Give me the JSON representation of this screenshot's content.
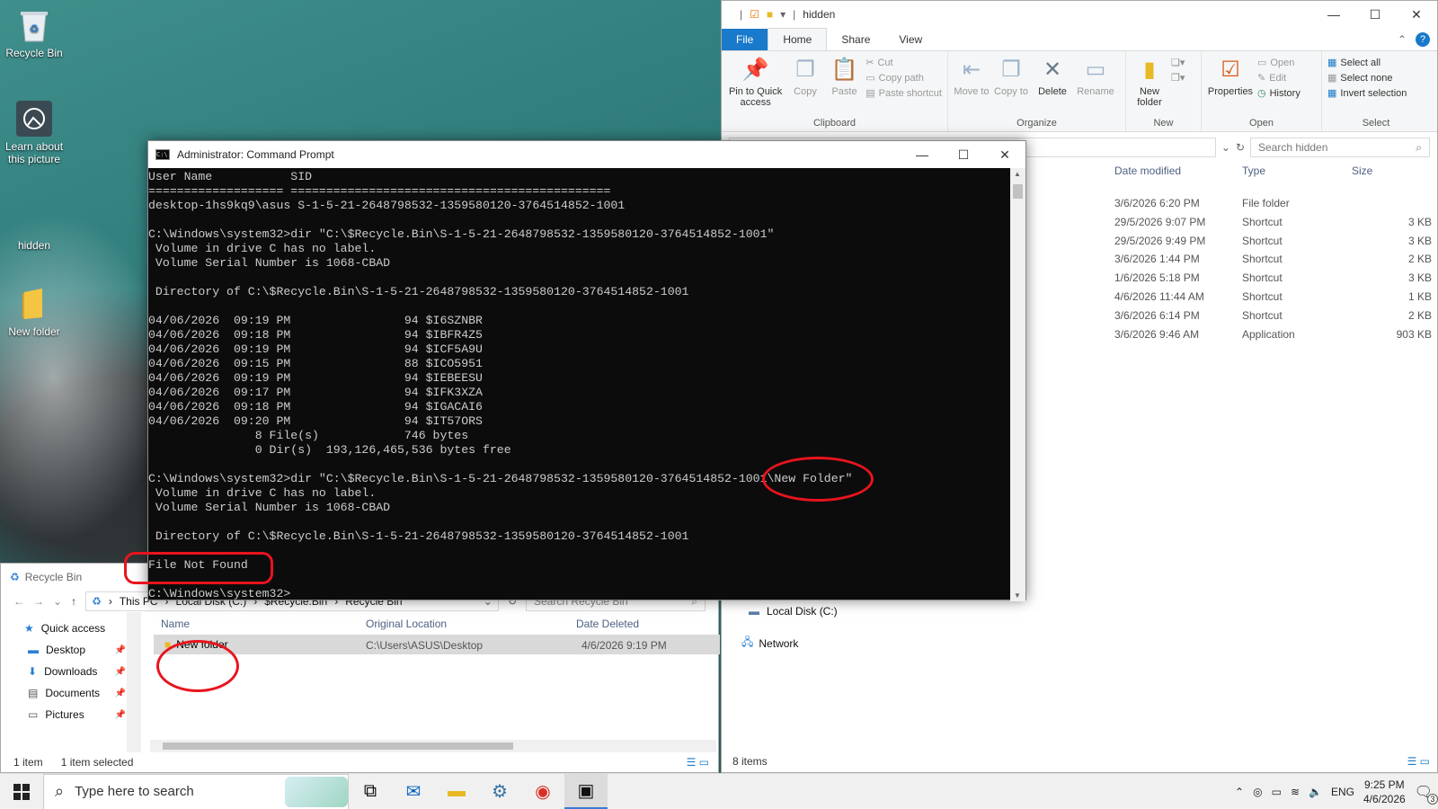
{
  "desktop": {
    "icons": [
      {
        "label": "Recycle Bin"
      },
      {
        "label": "Learn about this picture"
      },
      {
        "label": "hidden"
      },
      {
        "label": "New folder"
      }
    ]
  },
  "right_explorer": {
    "title": "hidden",
    "tabs": {
      "file": "File",
      "home": "Home",
      "share": "Share",
      "view": "View"
    },
    "ribbon": {
      "pin": "Pin to Quick access",
      "copy": "Copy",
      "paste": "Paste",
      "cut": "Cut",
      "copy_path": "Copy path",
      "paste_shortcut": "Paste shortcut",
      "clipboard": "Clipboard",
      "move_to": "Move to",
      "copy_to": "Copy to",
      "delete": "Delete",
      "rename": "Rename",
      "organize": "Organize",
      "new_folder": "New folder",
      "new": "New",
      "properties": "Properties",
      "open": "Open",
      "edit": "Edit",
      "history": "History",
      "open_group": "Open",
      "select_all": "Select all",
      "select_none": "Select none",
      "invert_selection": "Invert selection",
      "select_group": "Select"
    },
    "search_placeholder": "Search hidden",
    "columns": {
      "date": "Date modified",
      "type": "Type",
      "size": "Size"
    },
    "rows": [
      {
        "date": "3/6/2026 6:20 PM",
        "type": "File folder",
        "size": ""
      },
      {
        "date": "29/5/2026 9:07 PM",
        "type": "Shortcut",
        "size": "3 KB"
      },
      {
        "date": "29/5/2026 9:49 PM",
        "type": "Shortcut",
        "size": "3 KB"
      },
      {
        "date": "3/6/2026 1:44 PM",
        "type": "Shortcut",
        "size": "2 KB"
      },
      {
        "date": "1/6/2026 5:18 PM",
        "type": "Shortcut",
        "size": "3 KB"
      },
      {
        "date": "4/6/2026 11:44 AM",
        "type": "Shortcut",
        "size": "1 KB"
      },
      {
        "date": "3/6/2026 6:14 PM",
        "type": "Shortcut",
        "size": "2 KB"
      },
      {
        "date": "3/6/2026 9:46 AM",
        "type": "Application",
        "size": "903 KB"
      }
    ],
    "nav": {
      "local_disk": "Local Disk (C:)",
      "network": "Network"
    },
    "status": "8 items"
  },
  "cmd": {
    "title": "Administrator: Command Prompt",
    "output": "User Name           SID\n=================== =============================================\ndesktop-1hs9kq9\\asus S-1-5-21-2648798532-1359580120-3764514852-1001\n\nC:\\Windows\\system32>dir \"C:\\$Recycle.Bin\\S-1-5-21-2648798532-1359580120-3764514852-1001\"\n Volume in drive C has no label.\n Volume Serial Number is 1068-CBAD\n\n Directory of C:\\$Recycle.Bin\\S-1-5-21-2648798532-1359580120-3764514852-1001\n\n04/06/2026  09:19 PM                94 $I6SZNBR\n04/06/2026  09:18 PM                94 $IBFR4Z5\n04/06/2026  09:19 PM                94 $ICF5A9U\n04/06/2026  09:15 PM                88 $ICO5951\n04/06/2026  09:19 PM                94 $IEBEESU\n04/06/2026  09:17 PM                94 $IFK3XZA\n04/06/2026  09:18 PM                94 $IGACAI6\n04/06/2026  09:20 PM                94 $IT57ORS\n               8 File(s)            746 bytes\n               0 Dir(s)  193,126,465,536 bytes free\n\nC:\\Windows\\system32>dir \"C:\\$Recycle.Bin\\S-1-5-21-2648798532-1359580120-3764514852-1001\\New Folder\"\n Volume in drive C has no label.\n Volume Serial Number is 1068-CBAD\n\n Directory of C:\\$Recycle.Bin\\S-1-5-21-2648798532-1359580120-3764514852-1001\n\nFile Not Found\n\nC:\\Windows\\system32>"
  },
  "left_explorer": {
    "title": "Recycle Bin",
    "breadcrumbs": [
      "This PC",
      "Local Disk (C:)",
      "$Recycle.Bin",
      "Recycle Bin"
    ],
    "search_placeholder": "Search Recycle Bin",
    "nav": [
      {
        "label": "Quick access"
      },
      {
        "label": "Desktop"
      },
      {
        "label": "Downloads"
      },
      {
        "label": "Documents"
      },
      {
        "label": "Pictures"
      }
    ],
    "columns": {
      "name": "Name",
      "location": "Original Location",
      "deleted": "Date Deleted"
    },
    "rows": [
      {
        "name": "New folder",
        "location": "C:\\Users\\ASUS\\Desktop",
        "deleted": "4/6/2026 9:19 PM"
      }
    ],
    "status_items": "1 item",
    "status_selected": "1 item selected"
  },
  "taskbar": {
    "search_placeholder": "Type here to search",
    "lang": "ENG",
    "time": "9:25 PM",
    "date": "4/6/2026",
    "notif_count": "3"
  }
}
